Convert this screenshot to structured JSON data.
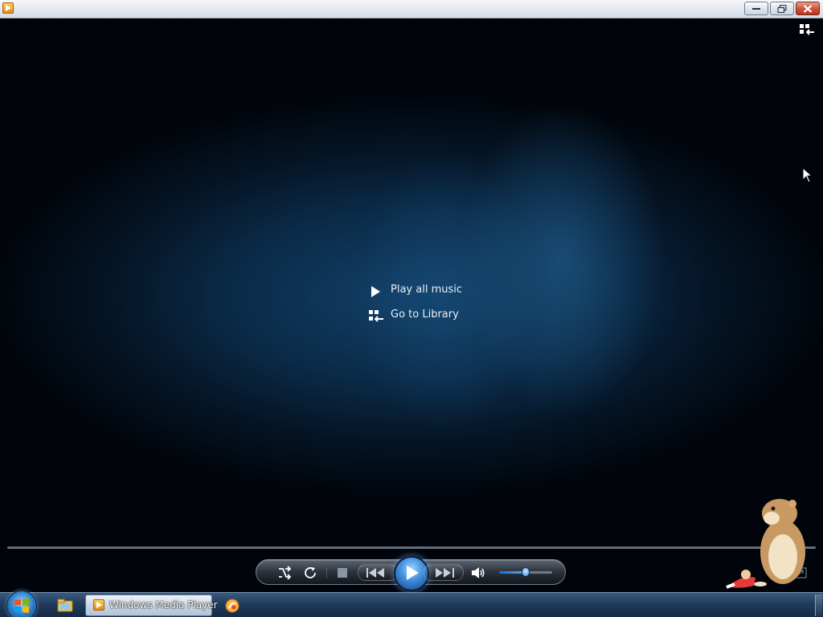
{
  "window": {
    "app_icon": "windows-media-player-icon",
    "controls": [
      "minimize-icon",
      "restore-icon",
      "close-icon"
    ]
  },
  "view": {
    "switch_icon": "switch-to-library-icon",
    "menu": [
      {
        "icon": "play-icon",
        "label": "Play all music"
      },
      {
        "icon": "library-icon",
        "label": "Go to Library"
      }
    ]
  },
  "player_controls": {
    "buttons": [
      "shuffle-icon",
      "repeat-icon",
      "stop-icon",
      "previous-icon",
      "play-icon",
      "next-icon",
      "volume-icon"
    ],
    "volume_level": 0.5,
    "seek_position": 0
  },
  "taskbar": {
    "start_icon": "windows-start-icon",
    "pinned": [
      "file-explorer-icon"
    ],
    "active_task": {
      "icon": "windows-media-player-icon",
      "label": "Windows Media Player"
    },
    "other_tasks": [
      "app-icon"
    ]
  },
  "colors": {
    "background_glow": "#114068",
    "play_button": "#3f8fdc",
    "taskbar": "#1f3a5a"
  }
}
